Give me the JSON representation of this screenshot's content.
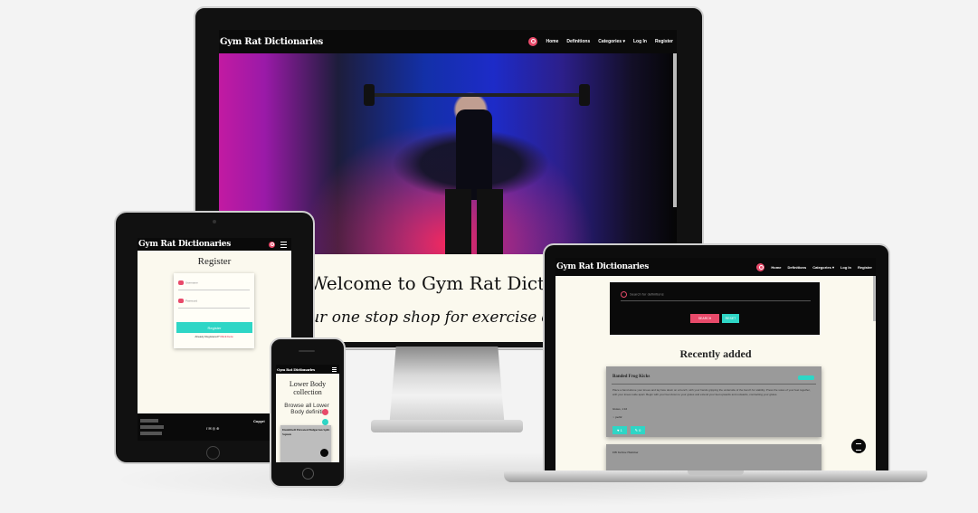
{
  "brand": "Gym Rat Dictionaries",
  "imac": {
    "nav": [
      "Home",
      "Definitions",
      "Categories ▾",
      "Log In",
      "Register"
    ],
    "welcome": "Welcome to Gym Rat Dictionari",
    "tagline": "our one stop shop for exercise defi"
  },
  "tablet": {
    "title": "Register",
    "username_placeholder": "Username",
    "password_placeholder": "Password",
    "register_btn": "Register",
    "note_prefix": "Already Registered?",
    "note_link": "Click here",
    "footer_copy": "Copyri",
    "footer_icons": "f ✉ ◎ ⊕"
  },
  "phone": {
    "brand": "Gym Rat Dictionaries",
    "title": "Lower Body collection",
    "subtitle": "Browse all Lower Body definiti",
    "card_title": "Dumbbell Elevated Bulgarian Split Squats"
  },
  "laptop": {
    "nav": [
      "Home",
      "Definitions",
      "Categories ▾",
      "Log In",
      "Register"
    ],
    "search_placeholder": "Search for definitions",
    "search_btn": "SEARCH",
    "reset_btn": "RESET",
    "recent": "Recently added",
    "card": {
      "title": "Banded Frog Kicks",
      "text": "Place a band above your knees and lay face down on a bench, with your hands gripping the underside of the bench for stability. Press the soles of your feet together, with your knees wide apart. Begin with your feet down to your glutes and extend your feet upwards and outwards, contracting your glutes.",
      "meta": "Glutes, 1:16",
      "author": "joe92",
      "likes": "1",
      "comments": "0"
    },
    "card2_title": "DB Incline Hammer"
  }
}
